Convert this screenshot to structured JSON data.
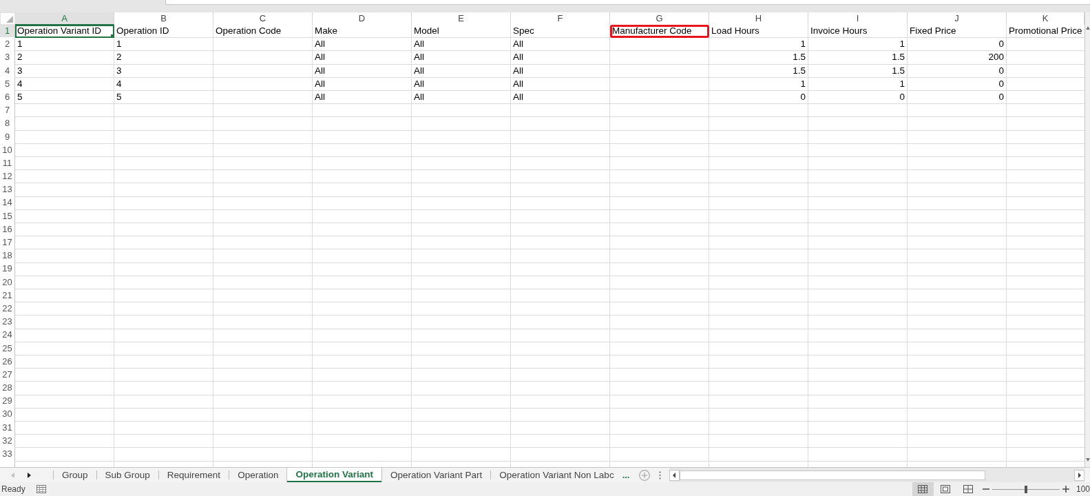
{
  "columns": [
    {
      "letter": "A",
      "selected": true
    },
    {
      "letter": "B",
      "selected": false
    },
    {
      "letter": "C",
      "selected": false
    },
    {
      "letter": "D",
      "selected": false
    },
    {
      "letter": "E",
      "selected": false
    },
    {
      "letter": "F",
      "selected": false
    },
    {
      "letter": "G",
      "selected": false
    },
    {
      "letter": "H",
      "selected": false
    },
    {
      "letter": "I",
      "selected": false
    },
    {
      "letter": "J",
      "selected": false
    },
    {
      "letter": "K",
      "selected": false
    }
  ],
  "rows": [
    {
      "number": "1",
      "selected": true,
      "cells": [
        {
          "kind": "text",
          "text": "Operation Variant ID",
          "selected": true,
          "annotated": false
        },
        {
          "kind": "text",
          "text": "Operation ID",
          "selected": false,
          "annotated": false
        },
        {
          "kind": "text",
          "text": "Operation Code",
          "selected": false,
          "annotated": false
        },
        {
          "kind": "text",
          "text": "Make",
          "selected": false,
          "annotated": false
        },
        {
          "kind": "text",
          "text": "Model",
          "selected": false,
          "annotated": false
        },
        {
          "kind": "text",
          "text": "Spec",
          "selected": false,
          "annotated": false
        },
        {
          "kind": "text",
          "text": "Manufacturer Code",
          "selected": false,
          "annotated": true
        },
        {
          "kind": "text",
          "text": "Load Hours",
          "selected": false,
          "annotated": false
        },
        {
          "kind": "text",
          "text": "Invoice Hours",
          "selected": false,
          "annotated": false
        },
        {
          "kind": "text",
          "text": "Fixed Price",
          "selected": false,
          "annotated": false
        },
        {
          "kind": "text",
          "text": "Promotional Price",
          "selected": false,
          "annotated": false
        }
      ]
    },
    {
      "number": "2",
      "selected": false,
      "cells": [
        {
          "kind": "text",
          "text": "1",
          "selected": false,
          "annotated": false
        },
        {
          "kind": "text",
          "text": "1",
          "selected": false,
          "annotated": false
        },
        {
          "kind": "blank",
          "selected": false,
          "annotated": false
        },
        {
          "kind": "text",
          "text": "All",
          "selected": false,
          "annotated": false
        },
        {
          "kind": "text",
          "text": "All",
          "selected": false,
          "annotated": false
        },
        {
          "kind": "text",
          "text": "All",
          "selected": false,
          "annotated": false
        },
        {
          "kind": "blank",
          "selected": false,
          "annotated": false
        },
        {
          "kind": "number",
          "text": "1",
          "selected": false,
          "annotated": false
        },
        {
          "kind": "number",
          "text": "1",
          "selected": false,
          "annotated": false
        },
        {
          "kind": "number",
          "text": "0",
          "selected": false,
          "annotated": false
        },
        {
          "kind": "blank",
          "selected": false,
          "annotated": false
        }
      ]
    },
    {
      "number": "3",
      "selected": false,
      "cells": [
        {
          "kind": "text",
          "text": "2",
          "selected": false,
          "annotated": false
        },
        {
          "kind": "text",
          "text": "2",
          "selected": false,
          "annotated": false
        },
        {
          "kind": "blank",
          "selected": false,
          "annotated": false
        },
        {
          "kind": "text",
          "text": "All",
          "selected": false,
          "annotated": false
        },
        {
          "kind": "text",
          "text": "All",
          "selected": false,
          "annotated": false
        },
        {
          "kind": "text",
          "text": "All",
          "selected": false,
          "annotated": false
        },
        {
          "kind": "blank",
          "selected": false,
          "annotated": false
        },
        {
          "kind": "number",
          "text": "1.5",
          "selected": false,
          "annotated": false
        },
        {
          "kind": "number",
          "text": "1.5",
          "selected": false,
          "annotated": false
        },
        {
          "kind": "number",
          "text": "200",
          "selected": false,
          "annotated": false
        },
        {
          "kind": "blank",
          "selected": false,
          "annotated": false
        }
      ]
    },
    {
      "number": "4",
      "selected": false,
      "cells": [
        {
          "kind": "text",
          "text": "3",
          "selected": false,
          "annotated": false
        },
        {
          "kind": "text",
          "text": "3",
          "selected": false,
          "annotated": false
        },
        {
          "kind": "blank",
          "selected": false,
          "annotated": false
        },
        {
          "kind": "text",
          "text": "All",
          "selected": false,
          "annotated": false
        },
        {
          "kind": "text",
          "text": "All",
          "selected": false,
          "annotated": false
        },
        {
          "kind": "text",
          "text": "All",
          "selected": false,
          "annotated": false
        },
        {
          "kind": "blank",
          "selected": false,
          "annotated": false
        },
        {
          "kind": "number",
          "text": "1.5",
          "selected": false,
          "annotated": false
        },
        {
          "kind": "number",
          "text": "1.5",
          "selected": false,
          "annotated": false
        },
        {
          "kind": "number",
          "text": "0",
          "selected": false,
          "annotated": false
        },
        {
          "kind": "blank",
          "selected": false,
          "annotated": false
        }
      ]
    },
    {
      "number": "5",
      "selected": false,
      "cells": [
        {
          "kind": "text",
          "text": "4",
          "selected": false,
          "annotated": false
        },
        {
          "kind": "text",
          "text": "4",
          "selected": false,
          "annotated": false
        },
        {
          "kind": "blank",
          "selected": false,
          "annotated": false
        },
        {
          "kind": "text",
          "text": "All",
          "selected": false,
          "annotated": false
        },
        {
          "kind": "text",
          "text": "All",
          "selected": false,
          "annotated": false
        },
        {
          "kind": "text",
          "text": "All",
          "selected": false,
          "annotated": false
        },
        {
          "kind": "blank",
          "selected": false,
          "annotated": false
        },
        {
          "kind": "number",
          "text": "1",
          "selected": false,
          "annotated": false
        },
        {
          "kind": "number",
          "text": "1",
          "selected": false,
          "annotated": false
        },
        {
          "kind": "number",
          "text": "0",
          "selected": false,
          "annotated": false
        },
        {
          "kind": "blank",
          "selected": false,
          "annotated": false
        }
      ]
    },
    {
      "number": "6",
      "selected": false,
      "cells": [
        {
          "kind": "text",
          "text": "5",
          "selected": false,
          "annotated": false
        },
        {
          "kind": "text",
          "text": "5",
          "selected": false,
          "annotated": false
        },
        {
          "kind": "blank",
          "selected": false,
          "annotated": false
        },
        {
          "kind": "text",
          "text": "All",
          "selected": false,
          "annotated": false
        },
        {
          "kind": "text",
          "text": "All",
          "selected": false,
          "annotated": false
        },
        {
          "kind": "text",
          "text": "All",
          "selected": false,
          "annotated": false
        },
        {
          "kind": "blank",
          "selected": false,
          "annotated": false
        },
        {
          "kind": "number",
          "text": "0",
          "selected": false,
          "annotated": false
        },
        {
          "kind": "number",
          "text": "0",
          "selected": false,
          "annotated": false
        },
        {
          "kind": "number",
          "text": "0",
          "selected": false,
          "annotated": false
        },
        {
          "kind": "blank",
          "selected": false,
          "annotated": false
        }
      ]
    },
    {
      "number": "7",
      "selected": false
    },
    {
      "number": "8",
      "selected": false
    },
    {
      "number": "9",
      "selected": false
    },
    {
      "number": "10",
      "selected": false
    },
    {
      "number": "11",
      "selected": false
    },
    {
      "number": "12",
      "selected": false
    },
    {
      "number": "13",
      "selected": false
    },
    {
      "number": "14",
      "selected": false
    },
    {
      "number": "15",
      "selected": false
    },
    {
      "number": "16",
      "selected": false
    },
    {
      "number": "17",
      "selected": false
    },
    {
      "number": "18",
      "selected": false
    },
    {
      "number": "19",
      "selected": false
    },
    {
      "number": "20",
      "selected": false
    },
    {
      "number": "21",
      "selected": false
    },
    {
      "number": "22",
      "selected": false
    },
    {
      "number": "23",
      "selected": false
    },
    {
      "number": "24",
      "selected": false
    },
    {
      "number": "25",
      "selected": false
    },
    {
      "number": "26",
      "selected": false
    },
    {
      "number": "27",
      "selected": false
    },
    {
      "number": "28",
      "selected": false
    },
    {
      "number": "29",
      "selected": false
    },
    {
      "number": "30",
      "selected": false
    },
    {
      "number": "31",
      "selected": false
    },
    {
      "number": "32",
      "selected": false
    },
    {
      "number": "33",
      "selected": false
    }
  ],
  "sheet_tabs": {
    "items": [
      {
        "label": "Group",
        "selected": false
      },
      {
        "label": "Sub Group",
        "selected": false
      },
      {
        "label": "Requirement",
        "selected": false
      },
      {
        "label": "Operation",
        "selected": false
      },
      {
        "label": "Operation Variant",
        "selected": true
      },
      {
        "label": "Operation Variant Part",
        "selected": false
      },
      {
        "label": "Operation Variant Non Labc",
        "selected": false
      }
    ],
    "more": "..."
  },
  "status_bar": {
    "text": "Ready",
    "views": [
      {
        "kind": "normal",
        "selected": true
      },
      {
        "kind": "page_layout",
        "selected": false
      },
      {
        "kind": "page_break",
        "selected": false
      }
    ],
    "zoom_slider": {
      "level": 0.5
    },
    "zoom_label": "100"
  }
}
